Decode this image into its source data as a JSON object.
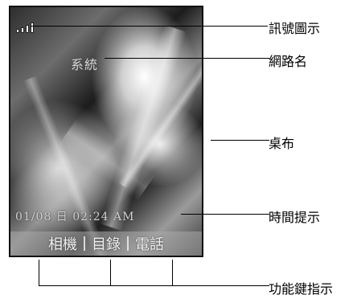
{
  "screen": {
    "menu_title": "系統",
    "date_time": "01/08 日 02:24 AM",
    "softkeys": {
      "left": "相機",
      "center": "目錄",
      "right": "電話"
    }
  },
  "callouts": {
    "signal": "訊號圖示",
    "network": "網路名",
    "wallpaper": "桌布",
    "time": "時間提示",
    "softkeys": "功能鍵指示"
  }
}
